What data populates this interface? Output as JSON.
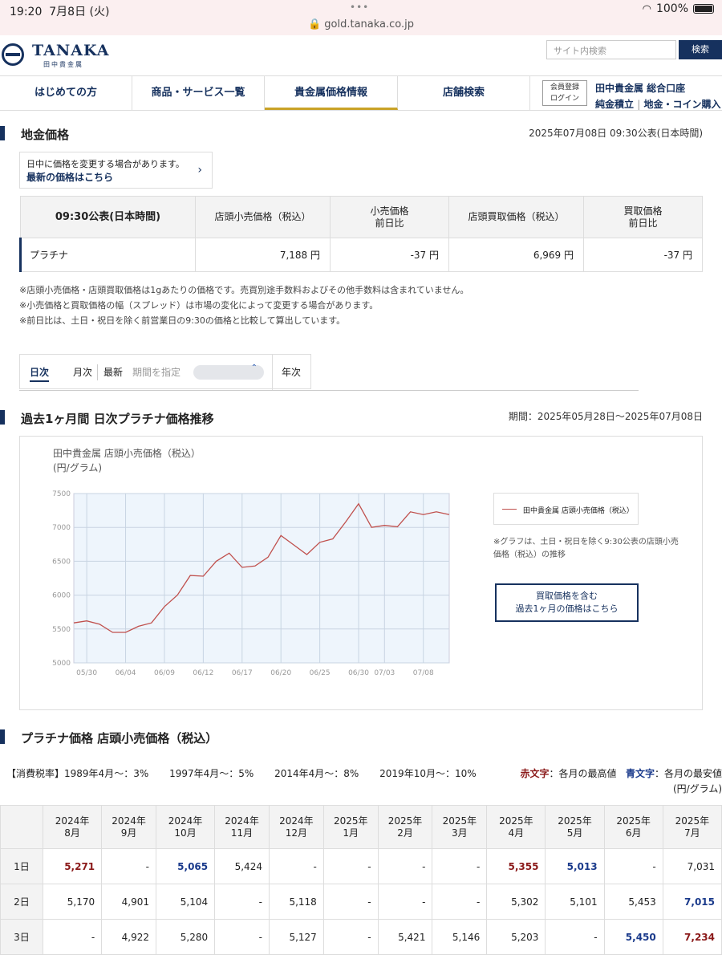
{
  "status_bar": {
    "time": "19:20",
    "date": "7月8日 (火)",
    "battery": "100%",
    "url": "gold.tanaka.co.jp"
  },
  "header": {
    "logo": "TANAKA",
    "logo_sub": "田中貴金属",
    "search_placeholder": "サイト内検索",
    "search_button": "検索"
  },
  "nav": {
    "items": [
      "はじめての方",
      "商品・サービス一覧",
      "貴金属価格情報",
      "店舗検索"
    ],
    "member_line1": "会員登録",
    "member_line2": "ログイン",
    "link1": "田中貴金属 総合口座",
    "link2": "純金積立",
    "link3": "地金・コイン購入"
  },
  "price_section": {
    "title": "地金価格",
    "published": "2025年07月08日 09:30公表(日本時間)",
    "notice_line1": "日中に価格を変更する場合があります。",
    "notice_link": "最新の価格はこちら",
    "table_header": [
      "09:30公表(日本時間)",
      "店頭小売価格（税込）",
      "小売価格",
      "前日比",
      "店頭買取価格（税込）",
      "買取価格",
      "前日比"
    ],
    "row": {
      "name": "プラチナ",
      "retail": "7,188 円",
      "retail_change": "-37 円",
      "buy": "6,969 円",
      "buy_change": "-37 円"
    },
    "notes": [
      "※店頭小売価格・店頭買取価格は1gあたりの価格です。売買別途手数料およびその他手数料は含まれていません。",
      "※小売価格と買取価格の幅（スプレッド）は市場の変化によって変更する場合があります。",
      "※前日比は、土日・祝日を除く前営業日の9:30の価格と比較して算出しています。"
    ]
  },
  "tabs": {
    "daily": "日次",
    "monthly": "月次",
    "latest": "最新",
    "specify": "期間を指定",
    "yearly": "年次"
  },
  "chart_section": {
    "title": "過去1ヶ月間 日次プラチナ価格推移",
    "period": "期間：2025年05月28日〜2025年07月08日",
    "chart_title": "田中貴金属 店頭小売価格（税込）",
    "unit": "(円/グラム)",
    "legend": "田中貴金属 店頭小売価格（税込）",
    "note": "※グラフは、土日・祝日を除く9:30公表の店頭小売価格（税込）の推移",
    "button_line1": "買取価格を含む",
    "button_line2": "過去1ヶ月の価格はこちら",
    "line_color": "#c0504d"
  },
  "chart_data": {
    "type": "line",
    "title": "田中貴金属 店頭小売価格（税込）",
    "ylabel": "(円/グラム)",
    "ylim": [
      5000,
      7500
    ],
    "yticks": [
      5000,
      5500,
      6000,
      6500,
      7000,
      7500
    ],
    "xtick_labels": [
      "05/30",
      "06/04",
      "06/09",
      "06/12",
      "06/17",
      "06/20",
      "06/25",
      "06/30",
      "07/03",
      "07/08"
    ],
    "xtick_index": [
      1,
      4,
      7,
      10,
      13,
      16,
      19,
      22,
      24,
      27
    ],
    "series": [
      {
        "name": "田中貴金属 店頭小売価格（税込）",
        "x": [
          "05/28",
          "05/29",
          "05/30",
          "06/02",
          "06/03",
          "06/04",
          "06/05",
          "06/06",
          "06/09",
          "06/10",
          "06/11",
          "06/12",
          "06/13",
          "06/16",
          "06/17",
          "06/18",
          "06/19",
          "06/20",
          "06/23",
          "06/24",
          "06/25",
          "06/26",
          "06/27",
          "06/30",
          "07/01",
          "07/02",
          "07/03",
          "07/04",
          "07/07",
          "07/08"
        ],
        "values": [
          5590,
          5620,
          5570,
          5450,
          5450,
          5540,
          5590,
          5830,
          6000,
          6290,
          6280,
          6500,
          6620,
          6410,
          6430,
          6560,
          6880,
          6740,
          6600,
          6780,
          6830,
          7080,
          7350,
          7000,
          7030,
          7010,
          7230,
          7190,
          7230,
          7188
        ]
      }
    ]
  },
  "monthly_section": {
    "title": "プラチナ価格 店頭小売価格（税込）",
    "tax_label": "【消費税率】",
    "tax_items": [
      "1989年4月〜：3%",
      "1997年4月〜：5%",
      "2014年4月〜：8%",
      "2019年10月〜：10%"
    ],
    "legend_red": "赤文字",
    "legend_red_text": "：各月の最高値",
    "legend_blue": "青文字",
    "legend_blue_text": "：各月の最安値",
    "unit": "(円/グラム)",
    "months": [
      [
        "2024年",
        "8月"
      ],
      [
        "2024年",
        "9月"
      ],
      [
        "2024年",
        "10月"
      ],
      [
        "2024年",
        "11月"
      ],
      [
        "2024年",
        "12月"
      ],
      [
        "2025年",
        "1月"
      ],
      [
        "2025年",
        "2月"
      ],
      [
        "2025年",
        "3月"
      ],
      [
        "2025年",
        "4月"
      ],
      [
        "2025年",
        "5月"
      ],
      [
        "2025年",
        "6月"
      ],
      [
        "2025年",
        "7月"
      ]
    ],
    "rows": [
      {
        "day": "1日",
        "cells": [
          {
            "v": "5,271",
            "c": "red"
          },
          {
            "v": "-"
          },
          {
            "v": "5,065",
            "c": "blue"
          },
          {
            "v": "5,424"
          },
          {
            "v": "-"
          },
          {
            "v": "-"
          },
          {
            "v": "-"
          },
          {
            "v": "-"
          },
          {
            "v": "5,355",
            "c": "red"
          },
          {
            "v": "5,013",
            "c": "blue"
          },
          {
            "v": "-"
          },
          {
            "v": "7,031"
          }
        ]
      },
      {
        "day": "2日",
        "cells": [
          {
            "v": "5,170"
          },
          {
            "v": "4,901"
          },
          {
            "v": "5,104"
          },
          {
            "v": "-"
          },
          {
            "v": "5,118"
          },
          {
            "v": "-"
          },
          {
            "v": "-"
          },
          {
            "v": "-"
          },
          {
            "v": "5,302"
          },
          {
            "v": "5,101"
          },
          {
            "v": "5,453"
          },
          {
            "v": "7,015",
            "c": "blue"
          }
        ]
      },
      {
        "day": "3日",
        "cells": [
          {
            "v": "-"
          },
          {
            "v": "4,922"
          },
          {
            "v": "5,280"
          },
          {
            "v": "-"
          },
          {
            "v": "5,127"
          },
          {
            "v": "-"
          },
          {
            "v": "5,421"
          },
          {
            "v": "5,146"
          },
          {
            "v": "5,203"
          },
          {
            "v": "-"
          },
          {
            "v": "5,450",
            "c": "blue"
          },
          {
            "v": "7,234",
            "c": "red"
          }
        ]
      }
    ]
  }
}
